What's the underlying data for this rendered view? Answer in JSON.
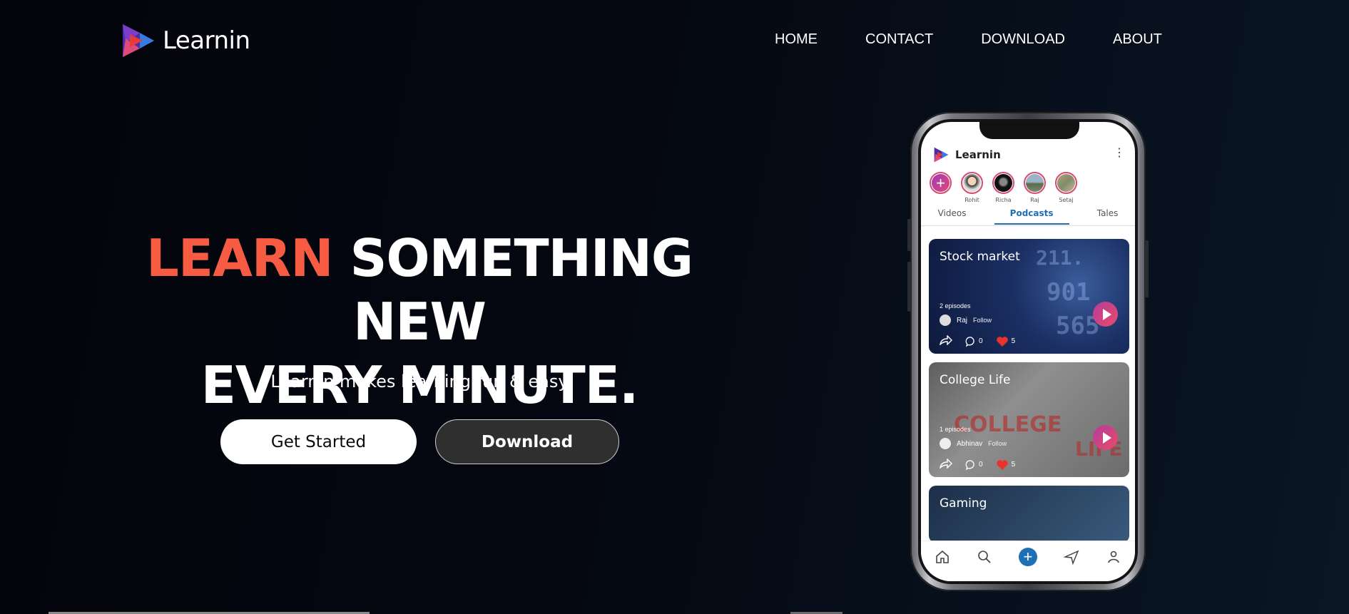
{
  "brand": {
    "name": "Learnin"
  },
  "nav": {
    "items": [
      {
        "label": "HOME"
      },
      {
        "label": "CONTACT"
      },
      {
        "label": "DOWNLOAD"
      },
      {
        "label": "ABOUT"
      }
    ]
  },
  "hero": {
    "title_accent": "LEARN",
    "title_rest_line1": " SOMETHING NEW",
    "title_line2": "EVERY MINUTE.",
    "subtitle": "Learnin makes learning fun & easy",
    "primary_button": "Get Started",
    "secondary_button": "Download"
  },
  "colors": {
    "accent": "#f75c42",
    "app_blue": "#1f6fb7",
    "play_gradient_start": "#b63c9a",
    "play_gradient_end": "#e84b6a"
  },
  "phone_app": {
    "title": "Learnin",
    "stories": [
      {
        "name": "Rohit"
      },
      {
        "name": "Richa"
      },
      {
        "name": "Raj"
      },
      {
        "name": "Setaj"
      }
    ],
    "tabs": [
      {
        "label": "Videos",
        "active": false
      },
      {
        "label": "Podcasts",
        "active": true
      },
      {
        "label": "Tales",
        "active": false
      }
    ],
    "cards": [
      {
        "title": "Stock market",
        "episodes": "2 episodes",
        "author": "Raj",
        "follow": "Follow",
        "comments": "0",
        "likes": "5"
      },
      {
        "title": "College Life",
        "episodes": "1 episodes",
        "author": "Abhinav",
        "follow": "Follow",
        "comments": "0",
        "likes": "5"
      },
      {
        "title": "Gaming"
      }
    ],
    "bottom_nav": [
      "home-icon",
      "search-icon",
      "add-icon",
      "send-icon",
      "profile-icon"
    ]
  }
}
